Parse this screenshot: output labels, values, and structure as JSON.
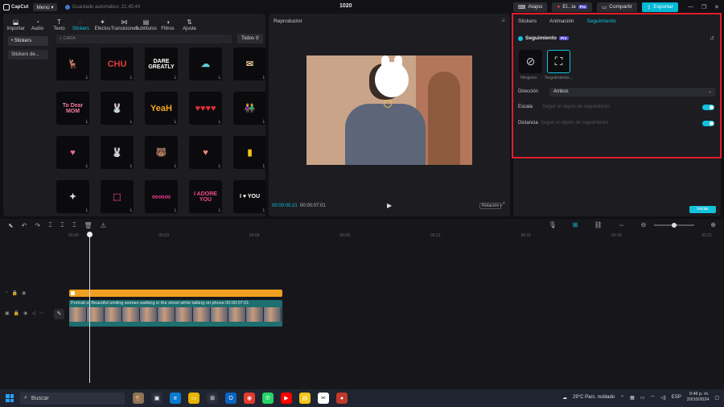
{
  "app": {
    "logo": "CapCut",
    "menu": "Menú",
    "autosave": "Guardado automático: 21:45:44",
    "project_title": "1020",
    "atajos": "Atajos",
    "user": "El...la",
    "pro_badge": "Pro",
    "compartir": "Compartir",
    "exportar": "Exportar"
  },
  "toolbar_tabs": [
    {
      "label": "Importar",
      "icon": "import-icon"
    },
    {
      "label": "Audio",
      "icon": "audio-icon"
    },
    {
      "label": "Texto",
      "icon": "text-icon"
    },
    {
      "label": "Stickers",
      "icon": "sticker-icon"
    },
    {
      "label": "Efectos",
      "icon": "effects-icon"
    },
    {
      "label": "Transiciones",
      "icon": "transitions-icon"
    },
    {
      "label": "Subtítulos",
      "icon": "subtitles-icon"
    },
    {
      "label": "Filtros",
      "icon": "filters-icon"
    },
    {
      "label": "Ajuste",
      "icon": "adjust-icon"
    }
  ],
  "active_tab": "Stickers",
  "stickers_panel": {
    "categories": [
      "• Stickers",
      "Stickers de..."
    ],
    "search_placeholder": "CARA",
    "filter": "Todos"
  },
  "stickers": [
    {
      "text": "🦌",
      "color": "#d9534f"
    },
    {
      "text": "CHU",
      "color": "#e23a3a"
    },
    {
      "text": "DARE GREATLY",
      "color": "#ffffff"
    },
    {
      "text": "☁",
      "color": "#5fd0d8"
    },
    {
      "text": "✉",
      "color": "#e0c28a"
    },
    {
      "text": "To Dear MOM",
      "color": "#f07aa0"
    },
    {
      "text": "🐰",
      "color": "#ffffff"
    },
    {
      "text": "YeaH",
      "color": "#f5a623"
    },
    {
      "text": "♥♥♥♥",
      "color": "#e0303a"
    },
    {
      "text": "👫",
      "color": "#e6a07a"
    },
    {
      "text": "♥",
      "color": "#f06aa0"
    },
    {
      "text": "🐰",
      "color": "#ffffff"
    },
    {
      "text": "🐻",
      "color": "#f2d6a0"
    },
    {
      "text": "♥",
      "color": "#f08a7a"
    },
    {
      "text": "▮",
      "color": "#f5c518"
    },
    {
      "text": "✦",
      "color": "#dddddd"
    },
    {
      "text": "⬚",
      "color": "#e03a8a"
    },
    {
      "text": "∞∞∞",
      "color": "#e03a8a"
    },
    {
      "text": "I ADORE YOU",
      "color": "#f04a8a"
    },
    {
      "text": "I ♥ YOU",
      "color": "#ffffff"
    }
  ],
  "player": {
    "title": "Reproductor",
    "current_time": "00:00:00:21",
    "total_time": "00:00:07:01",
    "ratio_label": "Relación"
  },
  "right_panel": {
    "tabs": [
      "Stickers",
      "Animación",
      "Seguimiento"
    ],
    "active_tab": "Seguimiento",
    "section_title": "Seguimiento",
    "options": [
      {
        "label": "Ninguno",
        "icon": "none-icon"
      },
      {
        "label": "Seguimiento...",
        "icon": "tracking-icon"
      }
    ],
    "direction_label": "Dirección",
    "direction_value": "Ambos",
    "scale_label": "Escala",
    "scale_hint": "Seguir el objeto de seguimiento",
    "distance_label": "Distancia",
    "distance_hint": "Seguir el objeto de seguimiento",
    "start_button": "Iniciar"
  },
  "timeline": {
    "ruler": [
      "00:00",
      "00:03",
      "00:06",
      "00:09",
      "00:12",
      "00:15",
      "00:18",
      "00:21"
    ],
    "video_clip_label": "Portrait of Beautiful smiling woman walking in the street while talking on phone  00:00:07:01"
  },
  "taskbar": {
    "search": "Buscar",
    "weather": "29°C  Parc. nublado",
    "lang": "ESP",
    "time": "9:46 p. m.",
    "date": "20/10/2024"
  },
  "colors": {
    "accent": "#12c3dd",
    "highlight_box": "#e01f2a",
    "sticker_clip": "#f0a020",
    "video_clip": "#1e6f6f"
  }
}
